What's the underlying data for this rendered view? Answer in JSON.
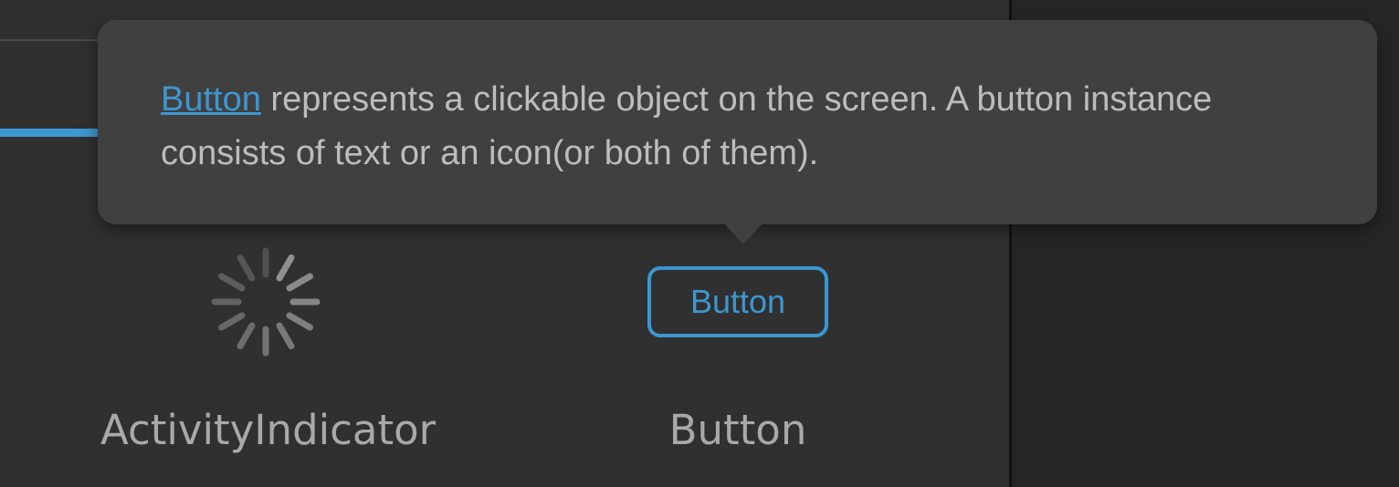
{
  "tooltip": {
    "link_text": "Button",
    "description": " represents a clickable object on the screen. A button instance consists of text or an icon(or both of them)."
  },
  "components": [
    {
      "name": "ActivityIndicator",
      "preview_icon": "spinner-icon"
    },
    {
      "name": "Button",
      "preview_label": "Button"
    }
  ],
  "colors": {
    "accent": "#3c97d0",
    "background": "#303030",
    "tooltip_background": "#404040",
    "text": "#bdbdbd",
    "label": "#a9a9a9"
  }
}
